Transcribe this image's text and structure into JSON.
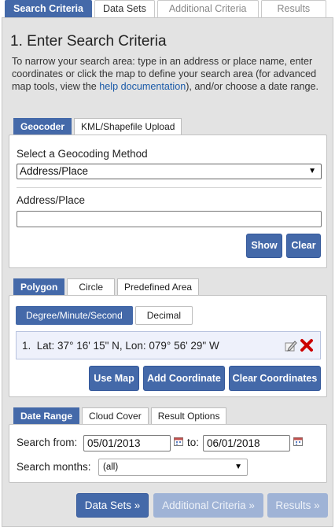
{
  "top_tabs": [
    "Search Criteria",
    "Data Sets",
    "Additional Criteria",
    "Results"
  ],
  "title": "1. Enter Search Criteria",
  "intro": {
    "before_link": "To narrow your search area: type in an address or place name, enter coordinates or click the map to define your search area (for advanced map tools, view the ",
    "link": "help documentation",
    "after_link": "), and/or choose a date range."
  },
  "geocoder": {
    "tabs": [
      "Geocoder",
      "KML/Shapefile Upload"
    ],
    "method_label": "Select a Geocoding Method",
    "method_value": "Address/Place",
    "address_label": "Address/Place",
    "address_value": "",
    "show_label": "Show",
    "clear_label": "Clear"
  },
  "polygon": {
    "tabs": [
      "Polygon",
      "Circle",
      "Predefined Area"
    ],
    "format_tabs": [
      "Degree/Minute/Second",
      "Decimal"
    ],
    "coordinates": [
      {
        "index": "1.",
        "text": "Lat: 37° 16' 15\" N, Lon: 079° 56' 29\" W"
      }
    ],
    "use_map_label": "Use Map",
    "add_coord_label": "Add Coordinate",
    "clear_coords_label": "Clear Coordinates"
  },
  "date": {
    "tabs": [
      "Date Range",
      "Cloud Cover",
      "Result Options"
    ],
    "from_label": "Search from:",
    "from_value": "05/01/2013",
    "to_label": "to:",
    "to_value": "06/01/2018",
    "months_label": "Search months:",
    "months_value": "(all)"
  },
  "nav": {
    "datasets": "Data Sets »",
    "additional": "Additional Criteria »",
    "results": "Results »"
  },
  "colors": {
    "accent": "#4469a9",
    "panel": "#e3e3e3",
    "delete": "#cc0000"
  }
}
